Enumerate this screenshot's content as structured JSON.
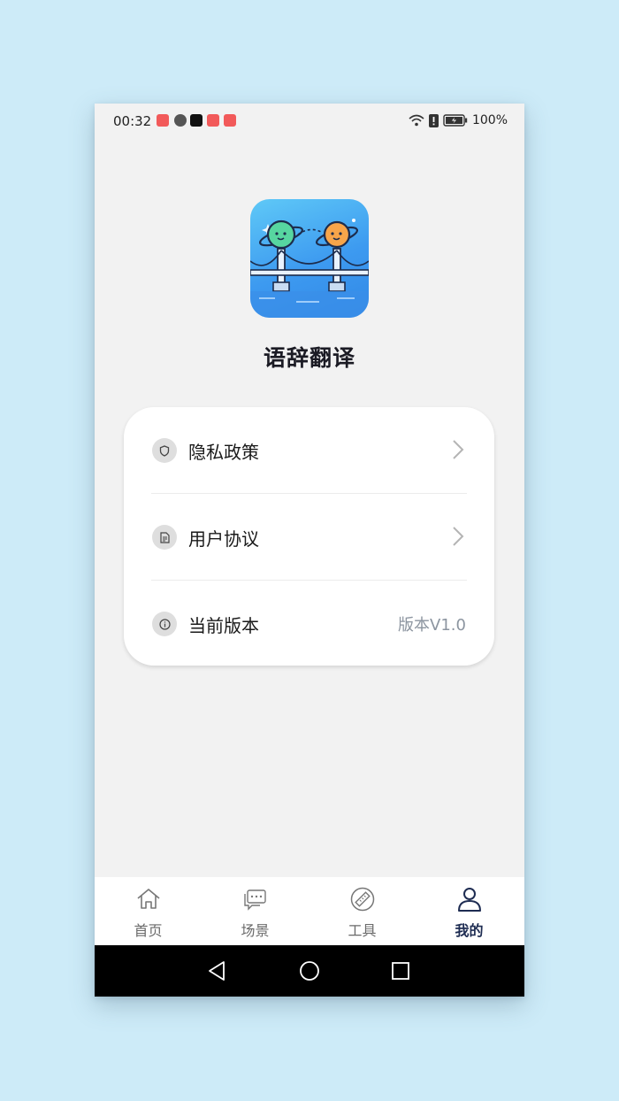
{
  "status_bar": {
    "time": "00:32",
    "battery": "100%",
    "icons": [
      "wifi-icon",
      "alert-icon",
      "battery-icon"
    ]
  },
  "app": {
    "name": "语辞翻译",
    "icon": "planets-bridge-logo"
  },
  "menu": {
    "items": [
      {
        "label": "隐私政策",
        "icon": "shield-icon",
        "trailing": "chevron-right-icon"
      },
      {
        "label": "用户协议",
        "icon": "document-icon",
        "trailing": "chevron-right-icon"
      },
      {
        "label": "当前版本",
        "icon": "info-icon",
        "value": "版本V1.0"
      }
    ]
  },
  "tabbar": {
    "tabs": [
      {
        "label": "首页",
        "icon": "home-icon",
        "active": false
      },
      {
        "label": "场景",
        "icon": "chat-icon",
        "active": false
      },
      {
        "label": "工具",
        "icon": "ruler-icon",
        "active": false
      },
      {
        "label": "我的",
        "icon": "user-icon",
        "active": true
      }
    ]
  },
  "colors": {
    "background": "#cdebf8",
    "accent": "#1e2c52",
    "icon_gradient_start": "#5fc9f7",
    "icon_gradient_end": "#3188e6"
  }
}
